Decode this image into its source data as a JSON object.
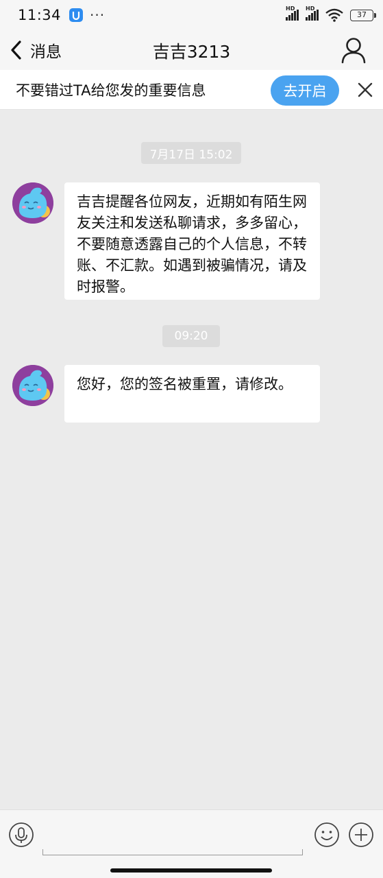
{
  "status_bar": {
    "time": "11:34",
    "more": "···",
    "signal_label": "HD",
    "battery": "37"
  },
  "header": {
    "back_label": "消息",
    "title": "吉吉3213"
  },
  "banner": {
    "text": "不要错过TA给您发的重要信息",
    "button_label": "去开启"
  },
  "messages": [
    {
      "time": "7月17日 15:02",
      "text": "吉吉提醒各位网友，近期如有陌生网友关注和发送私聊请求，多多留心，不要随意透露自己的个人信息，不转账、不汇款。如遇到被骗情况，请及时报警。"
    },
    {
      "time": "09:20",
      "text": "您好，您的签名被重置，请修改。"
    }
  ],
  "colors": {
    "accent": "#4aa3f0",
    "avatar_bg": "#8e3f9e",
    "chat_bg": "#ebebeb"
  },
  "icons": [
    "back-chevron-icon",
    "person-icon",
    "close-icon",
    "microphone-icon",
    "smiley-icon",
    "plus-icon"
  ]
}
